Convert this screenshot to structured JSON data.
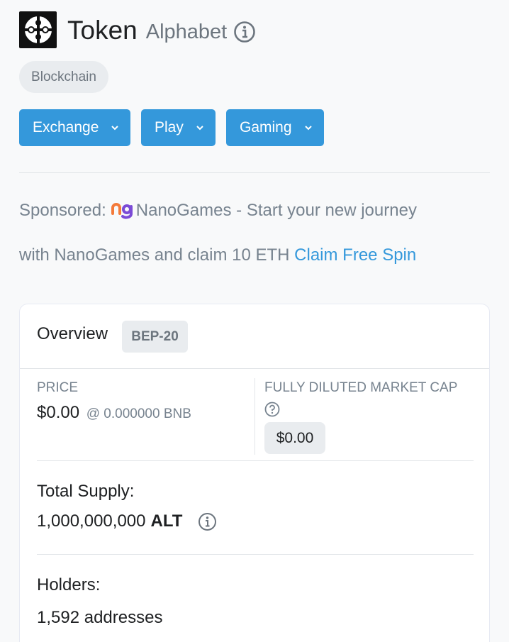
{
  "header": {
    "title": "Token",
    "subtitle": "Alphabet",
    "tag": "Blockchain"
  },
  "buttons": [
    {
      "label": "Exchange"
    },
    {
      "label": "Play"
    },
    {
      "label": "Gaming"
    }
  ],
  "sponsored": {
    "prefix": "Sponsored:",
    "text_line1": "NanoGames - Start your new journey",
    "text_line2": "with NanoGames and claim 10 ETH",
    "link": "Claim Free Spin"
  },
  "overview": {
    "title": "Overview",
    "badge": "BEP-20",
    "price_label": "PRICE",
    "price_value": "$0.00",
    "price_sub": "@ 0.000000 BNB",
    "mcap_label": "FULLY DILUTED MARKET CAP",
    "mcap_value": "$0.00",
    "total_supply_label": "Total Supply:",
    "total_supply_value": "1,000,000,000",
    "total_supply_symbol": "ALT",
    "holders_label": "Holders:",
    "holders_value": "1,592 addresses"
  },
  "colors": {
    "accent": "#3498db",
    "background": "#f8f9fa",
    "muted_text": "#77838f"
  }
}
